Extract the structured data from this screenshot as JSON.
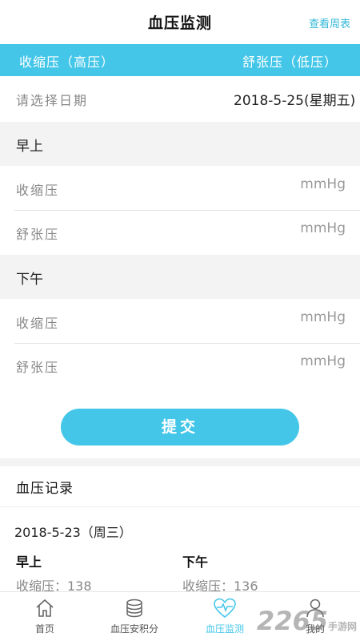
{
  "header": {
    "title": "血压监测",
    "link": "查看周表"
  },
  "banner": {
    "left": "收缩压（高压）",
    "right": "舒张压（低压）"
  },
  "date": {
    "label": "请选择日期",
    "value": "2018-5-25(星期五)"
  },
  "morning": {
    "title": "早上",
    "systolic_label": "收缩压",
    "systolic_unit": "mmHg",
    "diastolic_label": "舒张压",
    "diastolic_unit": "mmHg"
  },
  "afternoon": {
    "title": "下午",
    "systolic_label": "收缩压",
    "systolic_unit": "mmHg",
    "diastolic_label": "舒张压",
    "diastolic_unit": "mmHg"
  },
  "submit_label": "提交",
  "records": {
    "title": "血压记录",
    "date": "2018-5-23（周三）",
    "am_label": "早上",
    "pm_label": "下午",
    "am_systolic": "收缩压：138",
    "pm_systolic": "收缩压：136"
  },
  "tabs": [
    {
      "label": "首页",
      "icon": "home-icon"
    },
    {
      "label": "血压安积分",
      "icon": "coins-icon"
    },
    {
      "label": "血压监测",
      "icon": "heart-pulse-icon"
    },
    {
      "label": "我的",
      "icon": "user-icon"
    }
  ],
  "watermark": {
    "main": "2265",
    "sub": "手游网"
  },
  "colors": {
    "accent": "#43c6e8",
    "link": "#35b9d8",
    "section_bg": "#f3f3f3"
  }
}
